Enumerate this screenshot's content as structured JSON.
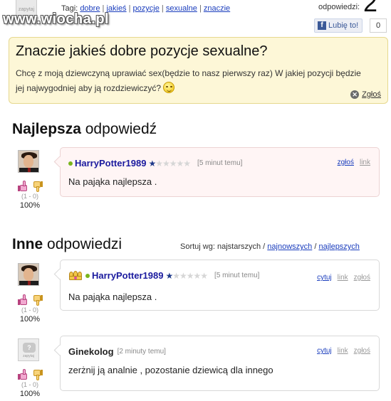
{
  "header": {
    "logo_text": "zapytaj",
    "watermark": "www.wiocha.pl",
    "tags_label": "Tagi:",
    "tags": [
      "dobre",
      "jakieś",
      "pozycje",
      "sexualne",
      "znaczie"
    ],
    "answers_label": "odpowiedzi:",
    "answers_count": "2",
    "fb_like_label": "Lubię to!",
    "fb_like_count": "0"
  },
  "question": {
    "title": "Znaczie jakieś dobre pozycje sexualne?",
    "body": "Chcę z moją dziewczyną uprawiać sex(będzie to nasz pierwszy raz) W jakiej pozycji będzie jej najwygodniej aby ją rozdziewiczyć?",
    "report_label": "Zgłoś"
  },
  "best_section": {
    "heading_bold": "Najlepsza",
    "heading_rest": "odpowiedź"
  },
  "other_section": {
    "heading_bold": "Inne",
    "heading_rest": "odpowiedzi",
    "sort_label": "Sortuj wg:",
    "sort_current": "najstarszych",
    "sort_newest": "najnowszych",
    "sort_best": "najlepszych"
  },
  "best_answer": {
    "author": "HarryPotter1989",
    "rank_stars": 1,
    "rank_max": 6,
    "time": "[5 minut temu]",
    "report": "zgłoś",
    "link": "link",
    "text": "Na pająka najlepsza .",
    "votes": "(1 - 0)",
    "percent": "100%"
  },
  "answers": [
    {
      "author": "HarryPotter1989",
      "rank_stars": 1,
      "rank_max": 6,
      "time": "[5 minut temu]",
      "quote": "cytuj",
      "link": "link",
      "report": "zgłoś",
      "text": "Na pająka najlepsza .",
      "votes": "(1 - 0)",
      "percent": "100%"
    },
    {
      "author": "Ginekolog",
      "avatar_label": "zapytaj",
      "time": "[2 minuty temu]",
      "quote": "cytuj",
      "link": "link",
      "report": "zgłoś",
      "text": "zerżnij ją analnie , pozostanie dziewicą dla innego",
      "votes": "(1 - 0)",
      "percent": "100%"
    }
  ],
  "icons": {
    "vote_up": "thumb-up-icon",
    "vote_down": "thumb-down-icon",
    "report": "close-circle-icon",
    "emoticon": "smiley-icon",
    "badge": "crown-icon"
  },
  "colors": {
    "link": "#1a3dbd",
    "question_bg": "#fdf7d7",
    "best_bg": "#fff5f5",
    "author": "#1a1a9e",
    "online": "#79b51c"
  }
}
